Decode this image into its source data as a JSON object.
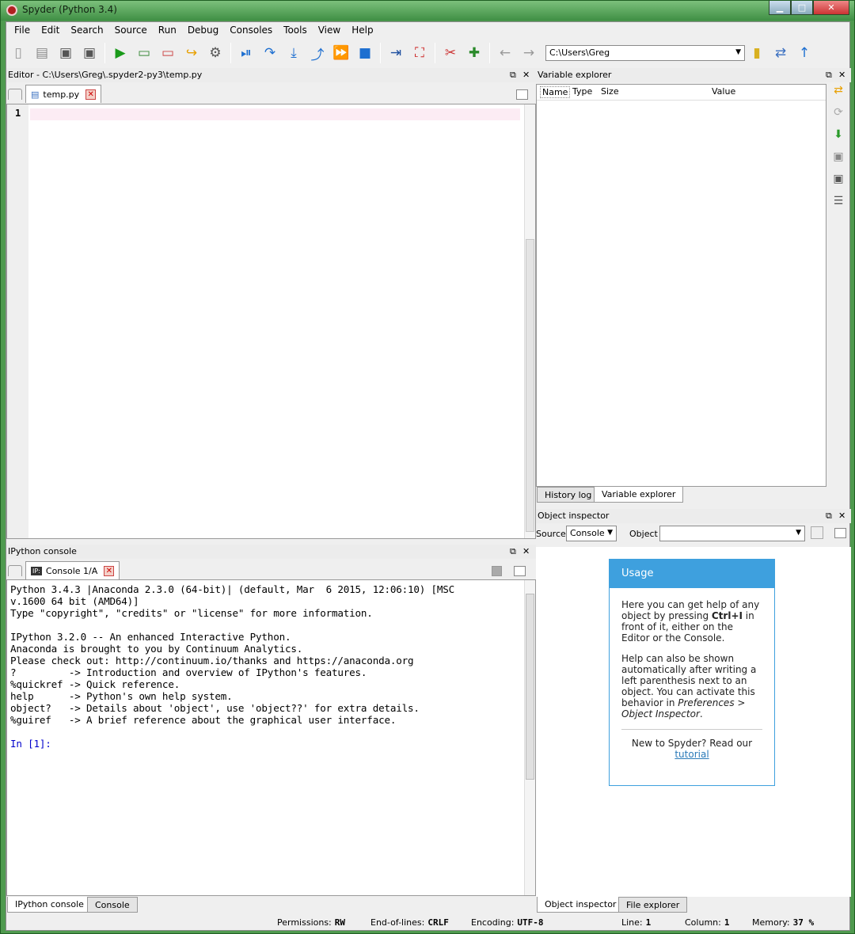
{
  "window": {
    "title": "Spyder (Python 3.4)"
  },
  "menu": [
    "File",
    "Edit",
    "Search",
    "Source",
    "Run",
    "Debug",
    "Consoles",
    "Tools",
    "View",
    "Help"
  ],
  "toolbar": {
    "path": "C:\\Users\\Greg"
  },
  "editor": {
    "header": "Editor - C:\\Users\\Greg\\.spyder2-py3\\temp.py",
    "tab_label": "temp.py",
    "line_number": "1"
  },
  "variable_explorer": {
    "header": "Variable explorer",
    "columns": [
      "Name",
      "Type",
      "Size",
      "Value"
    ],
    "bottom_tabs": [
      "History log",
      "Variable explorer"
    ]
  },
  "object_inspector": {
    "header": "Object inspector",
    "source_label": "Source",
    "source_value": "Console",
    "object_label": "Object",
    "usage_title": "Usage",
    "usage_p1_a": "Here you can get help of any object by pressing ",
    "usage_p1_key": "Ctrl+I",
    "usage_p1_b": " in front of it, either on the Editor or the Console.",
    "usage_p2_a": "Help can also be shown automatically after writing a left parenthesis next to an object. You can activate this behavior in ",
    "usage_p2_em": "Preferences > Object Inspector",
    "usage_p2_b": ".",
    "usage_footer": "New to Spyder? Read our",
    "usage_link": "tutorial",
    "bottom_tabs": [
      "Object inspector",
      "File explorer"
    ]
  },
  "console": {
    "header": "IPython console",
    "tab_label": "Console 1/A",
    "lines": [
      "Python 3.4.3 |Anaconda 2.3.0 (64-bit)| (default, Mar  6 2015, 12:06:10) [MSC",
      "v.1600 64 bit (AMD64)]",
      "Type \"copyright\", \"credits\" or \"license\" for more information.",
      "",
      "IPython 3.2.0 -- An enhanced Interactive Python.",
      "Anaconda is brought to you by Continuum Analytics.",
      "Please check out: http://continuum.io/thanks and https://anaconda.org",
      "?         -> Introduction and overview of IPython's features.",
      "%quickref -> Quick reference.",
      "help      -> Python's own help system.",
      "object?   -> Details about 'object', use 'object??' for extra details.",
      "%guiref   -> A brief reference about the graphical user interface.",
      ""
    ],
    "prompt": "In [1]:",
    "bottom_tabs": [
      "IPython console",
      "Console"
    ]
  },
  "status": {
    "permissions_label": "Permissions:",
    "permissions": "RW",
    "eol_label": "End-of-lines:",
    "eol": "CRLF",
    "encoding_label": "Encoding:",
    "encoding": "UTF-8",
    "line_label": "Line:",
    "line": "1",
    "column_label": "Column:",
    "column": "1",
    "memory_label": "Memory:",
    "memory": "37 %"
  }
}
